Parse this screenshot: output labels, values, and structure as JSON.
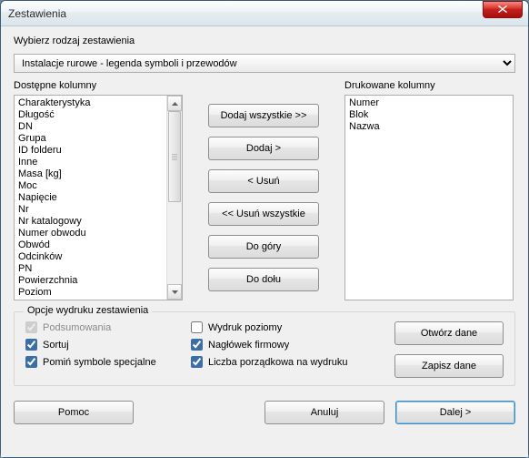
{
  "window": {
    "title": "Zestawienia"
  },
  "prompt_label": "Wybierz rodzaj zestawienia",
  "dropdown": {
    "selected": "Instalacje rurowe - legenda symboli i przewodów"
  },
  "labels": {
    "available": "Dostępne kolumny",
    "printed": "Drukowane kolumny"
  },
  "available_columns": [
    "Charakterystyka",
    "Długość",
    "DN",
    "Grupa",
    "ID folderu",
    "Inne",
    "Masa [kg]",
    "Moc",
    "Napięcie",
    "Nr",
    "Nr katalogowy",
    "Numer obwodu",
    "Obwód",
    "Odcinków",
    "PN",
    "Powierzchnia",
    "Poziom"
  ],
  "printed_columns": [
    "Numer",
    "Blok",
    "Nazwa"
  ],
  "buttons": {
    "add_all": "Dodaj wszystkie >>",
    "add": "Dodaj >",
    "remove": "< Usuń",
    "remove_all": "<< Usuń wszystkie",
    "move_up": "Do góry",
    "move_down": "Do dołu",
    "open_data": "Otwórz dane",
    "save_data": "Zapisz dane",
    "help": "Pomoc",
    "cancel": "Anuluj",
    "next": "Dalej >"
  },
  "options_group": {
    "legend": "Opcje wydruku zestawienia",
    "summaries": {
      "label": "Podsumowania",
      "checked": true,
      "enabled": false
    },
    "sort": {
      "label": "Sortuj",
      "checked": true,
      "enabled": true
    },
    "skip_special": {
      "label": "Pomiń symbole specjalne",
      "checked": true,
      "enabled": true
    },
    "print_horizontal": {
      "label": "Wydruk poziomy",
      "checked": false,
      "enabled": true
    },
    "company_header": {
      "label": "Nagłówek firmowy",
      "checked": true,
      "enabled": true
    },
    "ordinal_on_print": {
      "label": "Liczba porządkowa na wydruku",
      "checked": true,
      "enabled": true
    }
  }
}
